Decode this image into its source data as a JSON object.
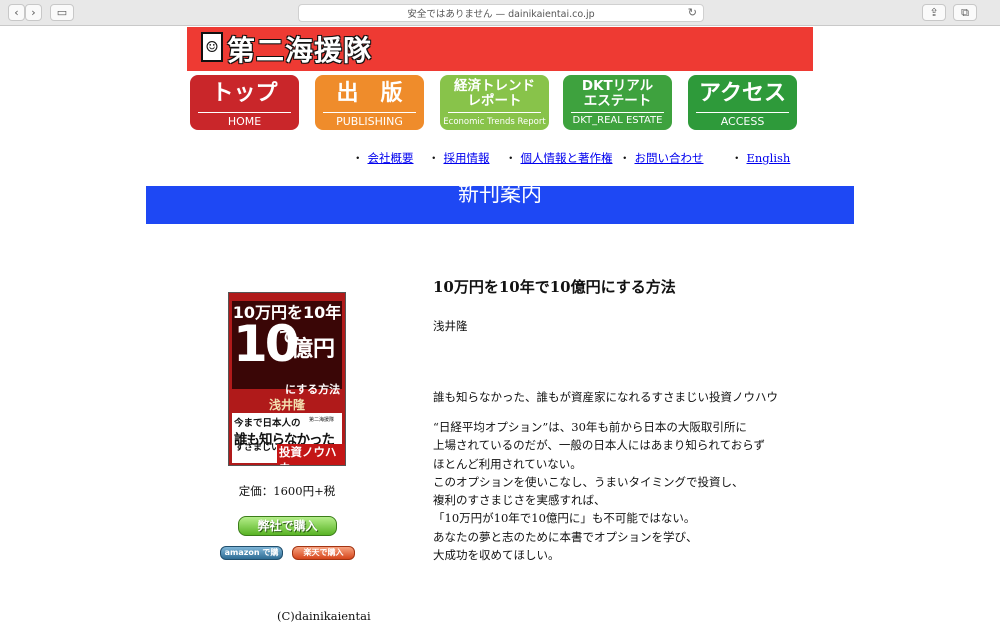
{
  "browser": {
    "url_text": "安全ではありません — dainikaientai.co.jp"
  },
  "header": {
    "site_title": "第二海援隊"
  },
  "nav_tiles": [
    {
      "label": "トップ",
      "sub": "HOME",
      "color": "#c9262a"
    },
    {
      "label": "出　版",
      "sub": "PUBLISHING",
      "color": "#ef8c2b"
    },
    {
      "label": "経済トレンドレポート",
      "sub": "Economic Trends Report",
      "color": "#88c34a"
    },
    {
      "label": "DKTリアルエステート",
      "sub": "DKT_REAL ESTATE",
      "color": "#3ea23e"
    },
    {
      "label": "アクセス",
      "sub": "ACCESS",
      "color": "#2e9a3a"
    }
  ],
  "text_nav": [
    {
      "label": "会社概要"
    },
    {
      "label": "採用情報"
    },
    {
      "label": "個人情報と著作権"
    },
    {
      "label": "お問い合わせ"
    },
    {
      "label": "English"
    }
  ],
  "section_title": "新刊案内",
  "book": {
    "cover_line1": "10万円を10年で",
    "cover_big": "10",
    "cover_big2": "億円",
    "cover_line3": "にする方法",
    "cover_author": "浅井隆",
    "cover_line5": "今まで日本人の",
    "cover_line6": "誰も知らなかった",
    "cover_line7": "すさまじい",
    "cover_line8": "投資ノウハウ",
    "cover_publisher": "第二海援隊",
    "price": "定価：1600円+税",
    "buy_main": "弊社で購入",
    "buy_amazon": "amazon で購入",
    "buy_rakuten": "楽天で購入",
    "title": "10万円を10年で10億円にする方法",
    "author": "浅井隆",
    "tagline": "誰も知らなかった、誰もが資産家になれるすさまじい投資ノウハウ",
    "description": [
      "“日経平均オプション”は、30年も前から日本の大阪取引所に",
      "上場されているのだが、一般の日本人にはあまり知られておらず",
      "ほとんど利用されていない。",
      "このオプションを使いこなし、うまいタイミングで投資し、",
      "複利のすさまじさを実感すれば、",
      "「10万円が10年で10億円に」も不可能ではない。",
      "あなたの夢と志のために本書でオプションを学び、",
      "大成功を収めてほしい。"
    ]
  },
  "footer": {
    "copyright": "(C)dainikaientai"
  },
  "colors": {
    "banner": "#ee3a33",
    "section_bar": "#1e48f4",
    "link": "#0000ee"
  }
}
